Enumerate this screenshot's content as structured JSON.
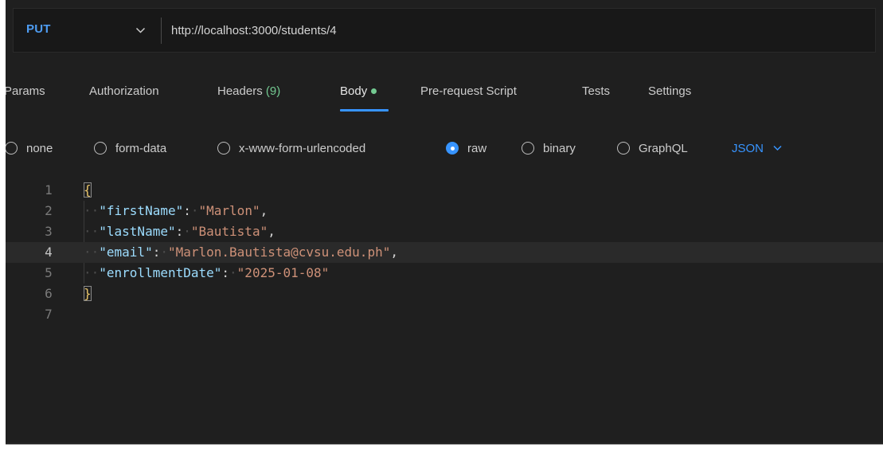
{
  "request": {
    "method": "PUT",
    "url": "http://localhost:3000/students/4"
  },
  "tabs": [
    {
      "label": "Params"
    },
    {
      "label": "Authorization"
    },
    {
      "label": "Headers",
      "count": "(9)"
    },
    {
      "label": "Body",
      "active": true,
      "indicator": "green-dot"
    },
    {
      "label": "Pre-request Script"
    },
    {
      "label": "Tests"
    },
    {
      "label": "Settings"
    }
  ],
  "body_types": {
    "options": [
      "none",
      "form-data",
      "x-www-form-urlencoded",
      "raw",
      "binary",
      "GraphQL"
    ],
    "selected": "raw",
    "format": "JSON"
  },
  "editor": {
    "current_line": 4,
    "line_numbers": [
      "1",
      "2",
      "3",
      "4",
      "5",
      "6",
      "7"
    ],
    "open_brace": "{",
    "close_brace": "}",
    "fields": [
      {
        "key": "\"firstName\"",
        "value": "\"Marlon\"",
        "sep": ":",
        "trail": ","
      },
      {
        "key": "\"lastName\"",
        "value": "\"Bautista\"",
        "sep": ":",
        "trail": ","
      },
      {
        "key": "\"email\"",
        "value": "\"Marlon.Bautista@cvsu.edu.ph\"",
        "sep": ":",
        "trail": ","
      },
      {
        "key": "\"enrollmentDate\"",
        "value": "\"2025-01-08\"",
        "sep": ":",
        "trail": ""
      }
    ]
  },
  "colors": {
    "background": "#1f1f1f",
    "accent": "#3794ff",
    "method": "#4e9cf2",
    "success": "#73c991",
    "json_key": "#9cdcfe",
    "json_string": "#ce9178"
  }
}
